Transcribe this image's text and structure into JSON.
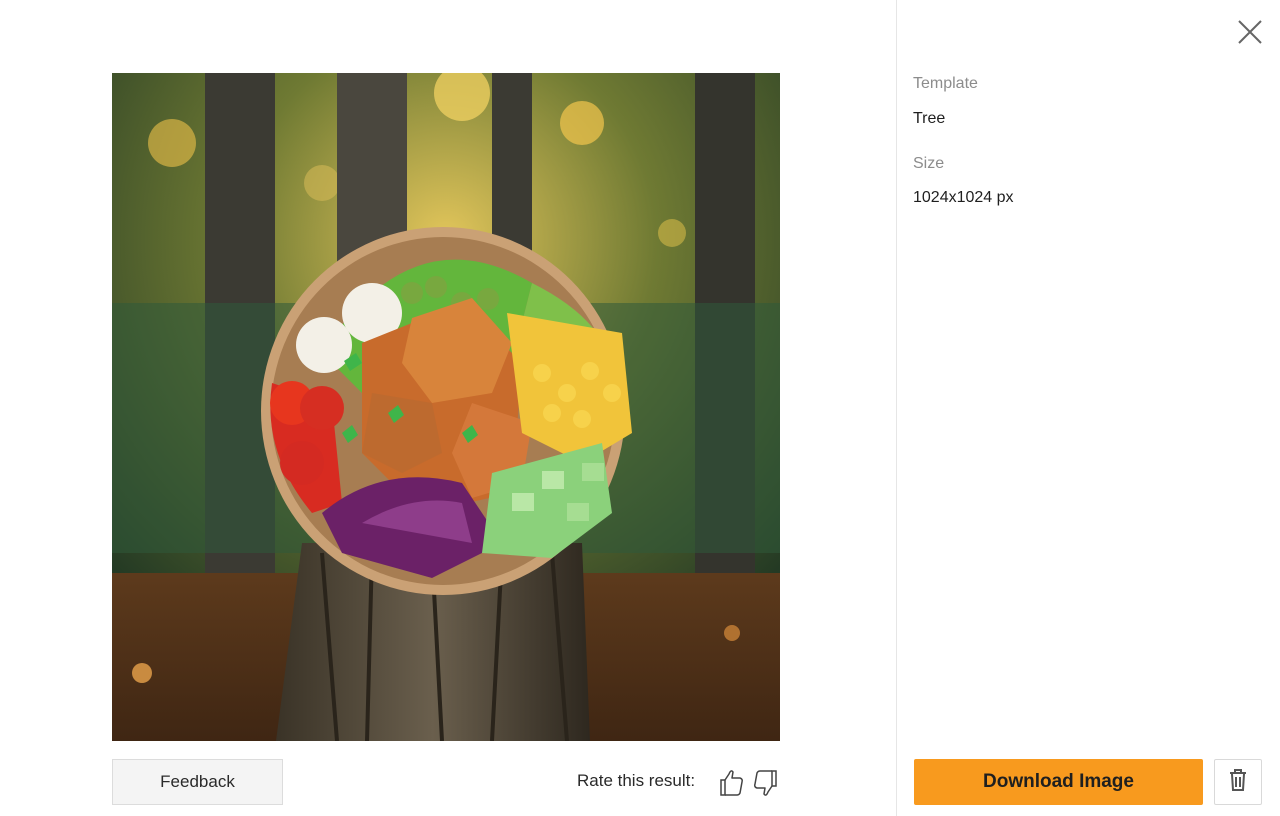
{
  "details": {
    "template_label": "Template",
    "template_value": "Tree",
    "size_label": "Size",
    "size_value": "1024x1024 px"
  },
  "actions": {
    "feedback_label": "Feedback",
    "rate_label": "Rate this result:",
    "download_label": "Download Image"
  },
  "icons": {
    "close": "close-icon",
    "thumbs_up": "thumbs-up-icon",
    "thumbs_down": "thumbs-down-icon",
    "delete": "trash-icon"
  },
  "colors": {
    "accent": "#f89a1e"
  }
}
